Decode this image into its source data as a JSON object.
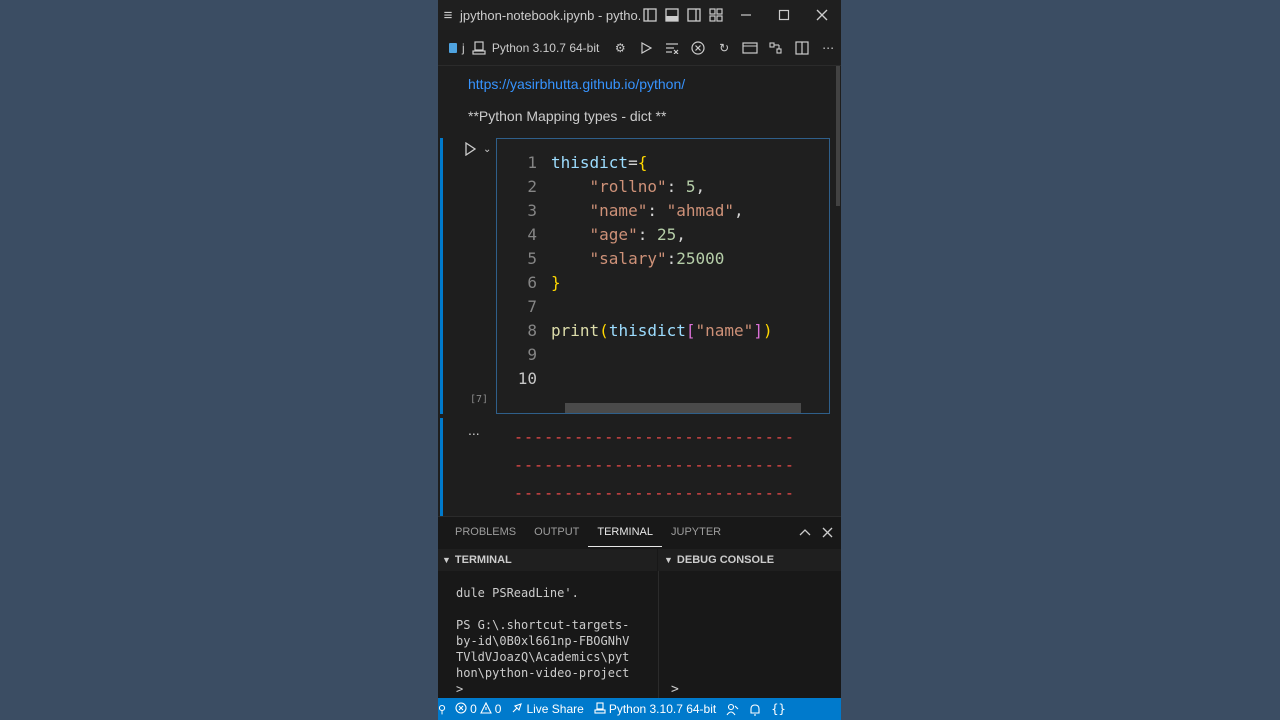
{
  "titlebar": {
    "title": "jpython-notebook.ipynb - pytho...",
    "menu_icon": "hamburger-icon",
    "layout_icons": [
      "layout-sidebar-icon",
      "layout-panel-icon",
      "layout-sidebar-right-icon",
      "customize-layout-icon"
    ],
    "controls": [
      "minimize-icon",
      "maximize-icon",
      "close-icon"
    ]
  },
  "toolbar": {
    "kernel_label": "Python 3.10.7 64-bit",
    "cursor_text": "j"
  },
  "notebook": {
    "link": "https://yasirbhutta.github.io/python/",
    "markdown": "**Python Mapping types - dict **",
    "exec_count": "[7]",
    "code_lines": [
      {
        "n": "1",
        "tokens": [
          [
            "t-var",
            "thisdict"
          ],
          [
            "t-pl",
            "="
          ],
          [
            "t-brace",
            "{"
          ]
        ]
      },
      {
        "n": "2",
        "tokens": [
          [
            "t-pl",
            "    "
          ],
          [
            "t-str",
            "\"rollno\""
          ],
          [
            "t-pl",
            ": "
          ],
          [
            "t-num",
            "5"
          ],
          [
            "t-pl",
            ","
          ]
        ]
      },
      {
        "n": "3",
        "tokens": [
          [
            "t-pl",
            "    "
          ],
          [
            "t-str",
            "\"name\""
          ],
          [
            "t-pl",
            ": "
          ],
          [
            "t-str",
            "\"ahmad\""
          ],
          [
            "t-pl",
            ","
          ]
        ]
      },
      {
        "n": "4",
        "tokens": [
          [
            "t-pl",
            "    "
          ],
          [
            "t-str",
            "\"age\""
          ],
          [
            "t-pl",
            ": "
          ],
          [
            "t-num",
            "25"
          ],
          [
            "t-pl",
            ","
          ]
        ]
      },
      {
        "n": "5",
        "tokens": [
          [
            "t-pl",
            "    "
          ],
          [
            "t-str",
            "\"salary\""
          ],
          [
            "t-pl",
            ":"
          ],
          [
            "t-num",
            "25000"
          ]
        ]
      },
      {
        "n": "6",
        "tokens": [
          [
            "t-brace",
            "}"
          ]
        ]
      },
      {
        "n": "7",
        "tokens": []
      },
      {
        "n": "8",
        "tokens": [
          [
            "t-fn",
            "print"
          ],
          [
            "t-brace",
            "("
          ],
          [
            "t-var",
            "thisdict"
          ],
          [
            "t-brace2",
            "["
          ],
          [
            "t-str",
            "\"name\""
          ],
          [
            "t-brace2",
            "]"
          ],
          [
            "t-brace",
            ")"
          ]
        ]
      },
      {
        "n": "9",
        "tokens": []
      },
      {
        "n": "10",
        "tokens": []
      }
    ],
    "output_dots": "...",
    "output_lines": [
      "----------------------------",
      "----------------------------",
      "----------------------------"
    ]
  },
  "panel": {
    "tabs": [
      "PROBLEMS",
      "OUTPUT",
      "TERMINAL",
      "JUPYTER"
    ],
    "active_tab": "TERMINAL",
    "terminal_header": "TERMINAL",
    "debug_header": "DEBUG CONSOLE",
    "terminal_text": "dule PSReadLine'.\n\nPS G:\\.shortcut-targets-\nby-id\\0B0xl661np-FBOGNhV\nTVldVJoazQ\\Academics\\pyt\nhon\\python-video-project\n>",
    "debug_prompt": ">"
  },
  "statusbar": {
    "errors": "0",
    "warnings": "0",
    "live_share": "Live Share",
    "kernel": "Python 3.10.7 64-bit"
  },
  "colors": {
    "accent": "#007acc",
    "link": "#3794ff",
    "output_red": "#f14c4c",
    "background": "#3b4d63"
  }
}
